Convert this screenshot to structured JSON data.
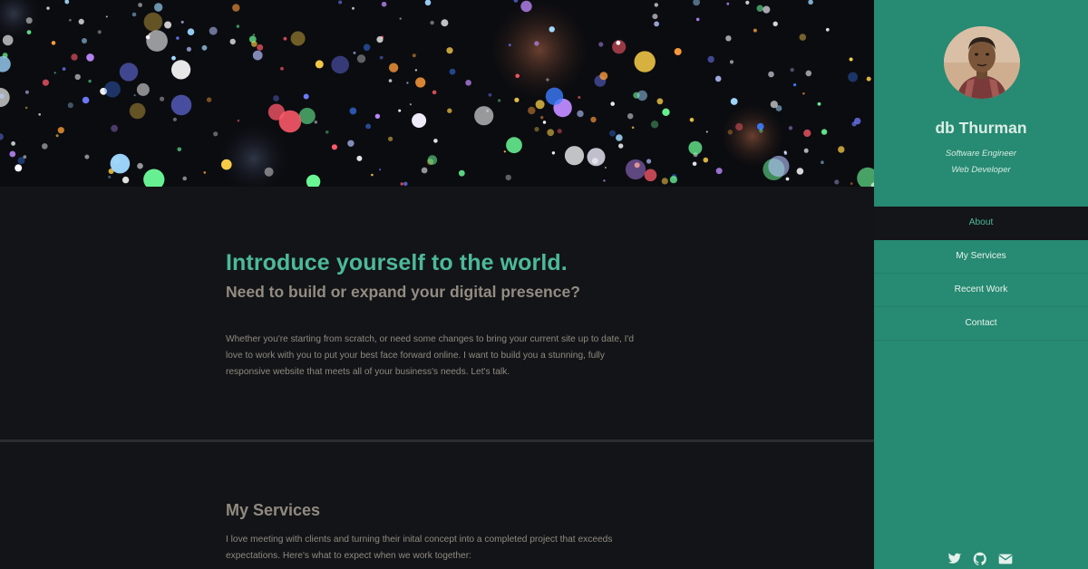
{
  "hero": {
    "image": "bokeh-lights-banner"
  },
  "about": {
    "headline": "Introduce yourself to the world.",
    "subheadline": "Need to build or expand your digital presence?",
    "body": "Whether you're starting from scratch, or need some changes to bring your current site up to date, I'd love to work with you to put your best face forward online. I want to build you a stunning, fully responsive website that meets all of your business's needs. Let's talk."
  },
  "services": {
    "title": "My Services",
    "body": "I love meeting with clients and turning their inital concept into a completed project that exceeds expectations. Here's what to expect when we work together:"
  },
  "sidebar": {
    "name": "db Thurman",
    "roles": [
      "Software Engineer",
      "Web Developer"
    ],
    "nav": [
      {
        "label": "About",
        "active": true
      },
      {
        "label": "My Services",
        "active": false
      },
      {
        "label": "Recent Work",
        "active": false
      },
      {
        "label": "Contact",
        "active": false
      }
    ],
    "socials": [
      "twitter-icon",
      "github-icon",
      "envelope-icon"
    ]
  },
  "colors": {
    "accent": "#4cb99a",
    "sidebar_bg": "#278a72",
    "page_bg": "#141518",
    "muted_text": "#928c82"
  }
}
